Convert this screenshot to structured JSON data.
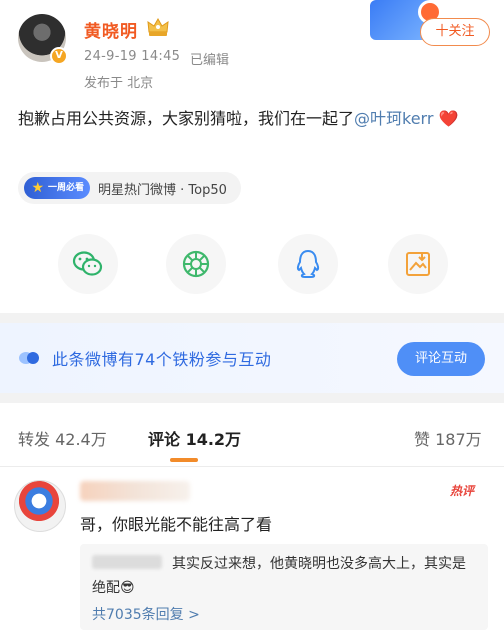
{
  "header": {
    "username": "黄晓明",
    "time": "24-9-19 14:45",
    "edited": "已编辑",
    "location": "发布于 北京",
    "follow_label": "十关注"
  },
  "post": {
    "text_prefix": "抱歉占用公共资源，大家别猜啦，我们在一起了",
    "mention": "@叶珂kerr",
    "emoji": "❤️"
  },
  "hot": {
    "badge": "一周必看",
    "text": "明星热门微博 · Top50"
  },
  "share": {
    "icons": [
      "wechat-icon",
      "moments-icon",
      "qq-icon",
      "save-image-icon"
    ]
  },
  "banner": {
    "text": "此条微博有74个铁粉参与互动",
    "button": "评论互动"
  },
  "tabs": {
    "repost": "转发 42.4万",
    "comments": "评论 14.2万",
    "likes": "赞 187万"
  },
  "comment": {
    "hot_tag": "热评",
    "text": "哥，你眼光能不能往高了看",
    "reply_text": "其实反过来想，他黄晓明也没多高大上，其实是绝配😎",
    "reply_count": "共7035条回复 >"
  },
  "colors": {
    "username": "#f15a22",
    "link": "#507daf",
    "banner_text": "#2f6ae0",
    "button": "#4f8ff7",
    "tab_underline": "#f28b2a"
  }
}
